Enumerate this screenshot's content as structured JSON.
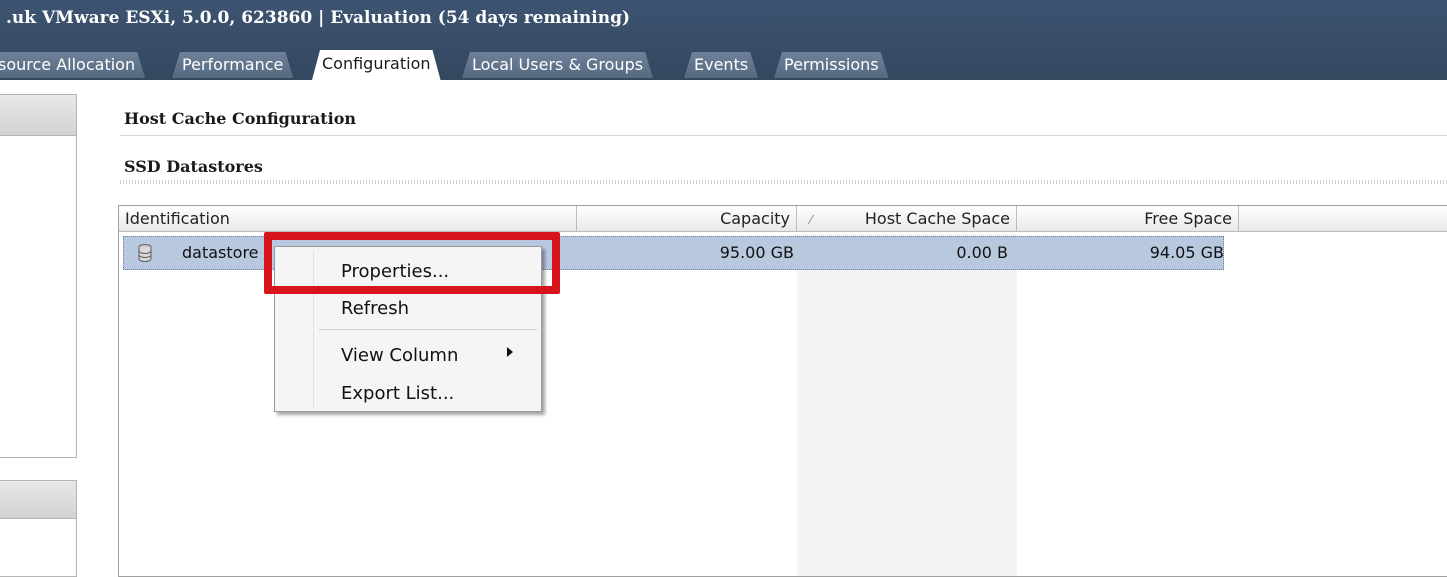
{
  "window": {
    "title": ".uk VMware ESXi, 5.0.0, 623860 | Evaluation (54 days remaining)"
  },
  "tabs": [
    {
      "label": "source Allocation",
      "active": false
    },
    {
      "label": "Performance",
      "active": false
    },
    {
      "label": "Configuration",
      "active": true
    },
    {
      "label": "Local Users & Groups",
      "active": false
    },
    {
      "label": "Events",
      "active": false
    },
    {
      "label": "Permissions",
      "active": false
    }
  ],
  "main": {
    "section_title": "Host Cache Configuration",
    "subsection_title": "SSD Datastores"
  },
  "table": {
    "columns": [
      {
        "label": "Identification"
      },
      {
        "label": "Capacity"
      },
      {
        "label": "Host Cache Space"
      },
      {
        "label": "Free Space"
      }
    ],
    "sorted_column": "Host Cache Space",
    "rows": [
      {
        "identification": "datastore",
        "capacity": "95.00 GB",
        "host_cache_space": "0.00 B",
        "free_space": "94.05 GB"
      }
    ]
  },
  "context_menu": {
    "items": [
      {
        "label": "Properties...",
        "highlighted": true
      },
      {
        "label": "Refresh"
      },
      {
        "label": "View Column",
        "has_submenu": true
      },
      {
        "label": "Export List..."
      }
    ]
  },
  "colors": {
    "titlebar": "#3d5471",
    "selection": "#b8c8de",
    "highlight_box": "#d7141b"
  },
  "icons": {
    "datastore": "datastore-icon",
    "submenu": "chevron-right-icon",
    "sort": "sort-indicator-icon"
  }
}
